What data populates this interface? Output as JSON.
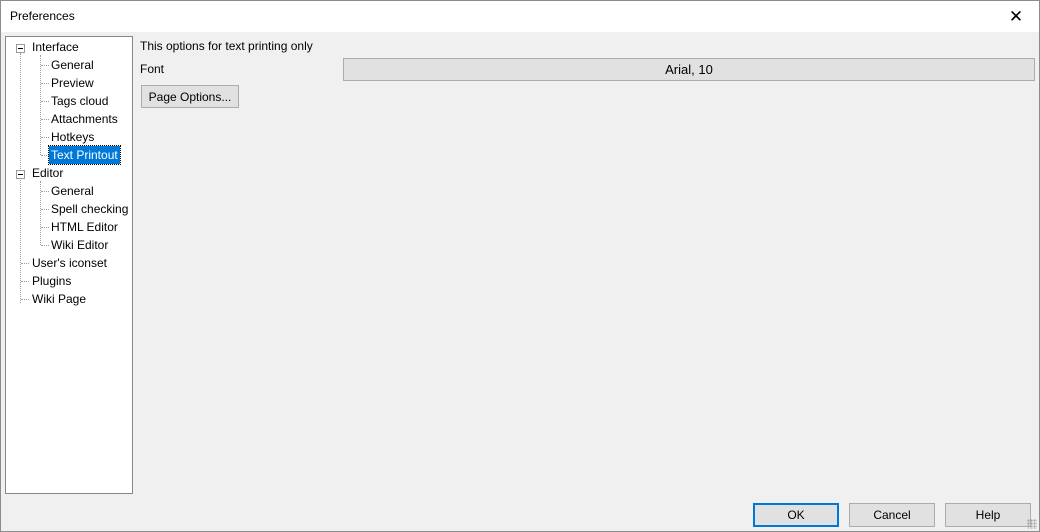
{
  "window": {
    "title": "Preferences"
  },
  "tree": {
    "interface": {
      "label": "Interface",
      "children": [
        "General",
        "Preview",
        "Tags cloud",
        "Attachments",
        "Hotkeys",
        "Text Printout"
      ]
    },
    "editor": {
      "label": "Editor",
      "children": [
        "General",
        "Spell checking",
        "HTML Editor",
        "Wiki Editor"
      ]
    },
    "others": [
      "User's iconset",
      "Plugins",
      "Wiki Page"
    ],
    "selected": "Text Printout"
  },
  "panel": {
    "description": "This options for text printing only",
    "font_label": "Font",
    "font_value": "Arial, 10",
    "page_options_label": "Page Options..."
  },
  "footer": {
    "ok_label": "OK",
    "cancel_label": "Cancel",
    "help_label": "Help"
  },
  "colors": {
    "selection": "#0078d7",
    "window_bg": "#f0f0f0",
    "button_bg": "#e1e1e1"
  }
}
